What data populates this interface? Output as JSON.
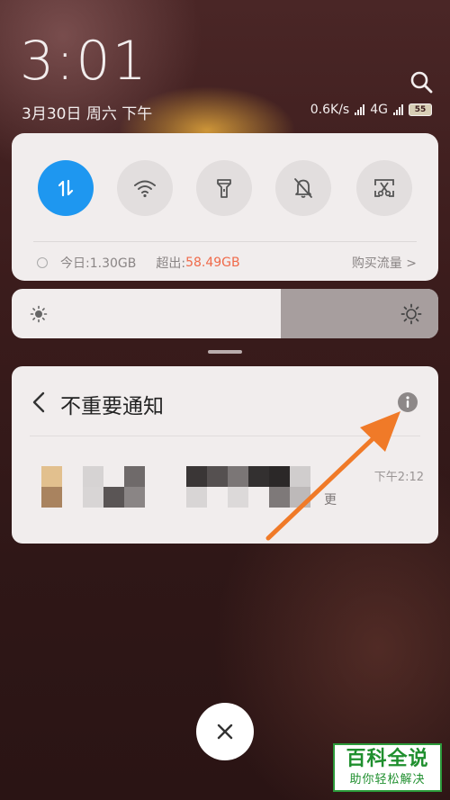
{
  "status_bar": {
    "time": "3:01",
    "date": "3月30日 周六 下午",
    "speed": "0.6K/s",
    "network": "4G",
    "battery": "55"
  },
  "quick_settings": {
    "toggles": [
      {
        "name": "mobile-data",
        "icon": "arrows-updown-icon",
        "on": true
      },
      {
        "name": "wifi",
        "icon": "wifi-icon",
        "on": false
      },
      {
        "name": "flashlight",
        "icon": "flashlight-icon",
        "on": false
      },
      {
        "name": "mute",
        "icon": "bell-off-icon",
        "on": false
      },
      {
        "name": "screenshot",
        "icon": "scissors-icon",
        "on": false
      }
    ],
    "data_today": "今日:1.30GB",
    "over_label": "超出:",
    "over_value": "58.49GB",
    "buy_data": "购买流量 >"
  },
  "brightness": {
    "level": 0.63
  },
  "notification": {
    "title": "不重要通知",
    "time": "下午2:12",
    "tail_char": "更"
  },
  "colors": {
    "accent": "#1e97f0",
    "over": "#f06a4a",
    "arrow": "#f07a28"
  },
  "watermark": {
    "line1": "百科全说",
    "line2": "助你轻松解决"
  }
}
